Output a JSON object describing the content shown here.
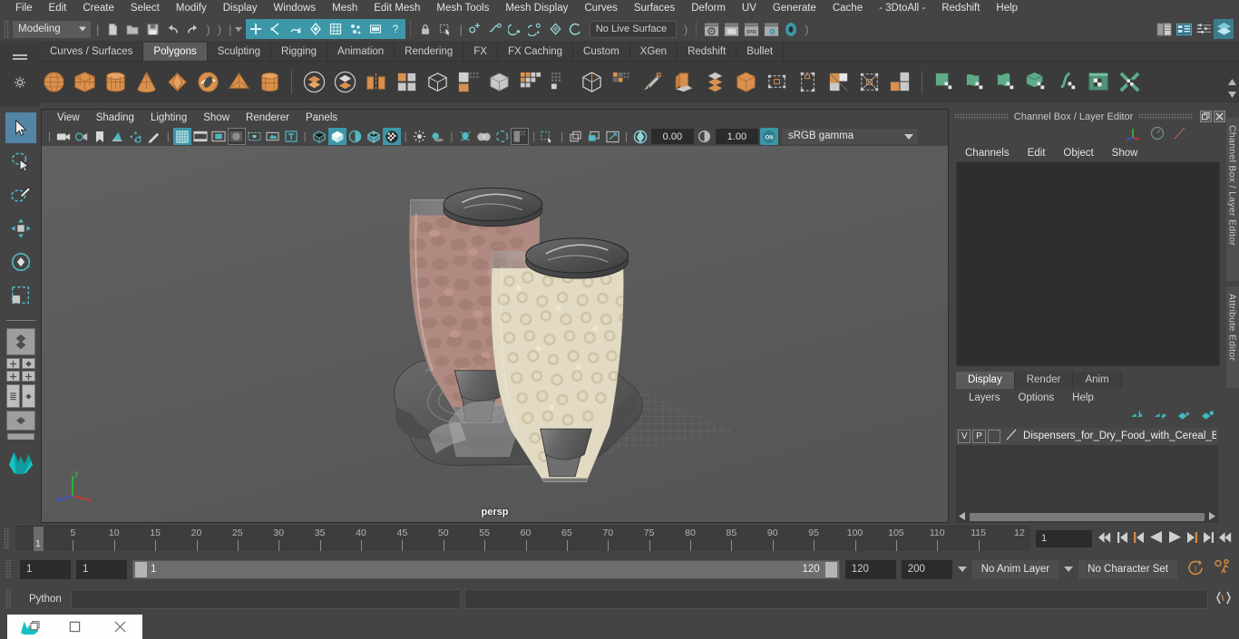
{
  "menubar": {
    "items": [
      "File",
      "Edit",
      "Create",
      "Select",
      "Modify",
      "Display",
      "Windows",
      "Mesh",
      "Edit Mesh",
      "Mesh Tools",
      "Mesh Display",
      "Curves",
      "Surfaces",
      "Deform",
      "UV",
      "Generate",
      "Cache",
      "- 3DtoAll -",
      "Redshift",
      "Help"
    ]
  },
  "statusline": {
    "menuset": "Modeling",
    "live_surface": "No Live Surface",
    "icons": [
      "new-scene-icon",
      "open-scene-icon",
      "save-scene-icon",
      "undo-icon",
      "redo-icon",
      "select-by-hierarchy-icon",
      "select-by-object-icon",
      "select-by-component-icon",
      "select-mask-icon",
      "snap-to-grid-icon",
      "snap-to-curve-icon",
      "snap-to-point-icon",
      "snap-to-projected-center-icon",
      "snap-to-view-plane-icon",
      "make-live-icon",
      "lock-icon",
      "selection-highlight-icon",
      "construction-history-icon",
      "render-current-frame-icon",
      "ipr-render-icon",
      "render-settings-icon",
      "hypershade-icon",
      "outliner-icon",
      "attribute-editor-icon",
      "tool-settings-icon",
      "channel-box-icon"
    ]
  },
  "shelf": {
    "tabs": [
      "Curves / Surfaces",
      "Polygons",
      "Sculpting",
      "Rigging",
      "Animation",
      "Rendering",
      "FX",
      "FX Caching",
      "Custom",
      "XGen",
      "Redshift",
      "Bullet"
    ],
    "active_tab": "Polygons",
    "icons": [
      "poly-sphere-icon",
      "poly-cube-icon",
      "poly-cylinder-icon",
      "poly-cone-icon",
      "poly-plane-icon",
      "poly-torus-icon",
      "poly-pyramid-icon",
      "poly-prism-icon",
      "combine-icon",
      "separate-icon",
      "extract-icon",
      "poly-booleans-icon",
      "smooth-icon",
      "sculpt-geometry-icon",
      "bevel-icon",
      "extrude-icon",
      "merge-icon",
      "quad-draw-icon",
      "multi-cut-icon",
      "insert-edge-loop-icon",
      "offset-edge-loop-icon",
      "add-divisions-icon",
      "mirror-icon",
      "append-polygon-icon",
      "target-weld-icon",
      "crease-icon",
      "fill-hole-icon",
      "uv-editor-icon",
      "uv-planar-icon",
      "uv-cylindrical-icon",
      "uv-automatic-icon",
      "uv-unfold-icon",
      "uv-layout-icon",
      "uv-snapshot-icon"
    ]
  },
  "toolbox": {
    "items": [
      "select-tool",
      "lasso-select-tool",
      "paint-select-tool",
      "move-tool",
      "rotate-tool",
      "scale-tool",
      "last-tool-used",
      "quad-view-layout",
      "two-pane-layout",
      "outliner-persp-layout",
      "hypergraph-layout",
      "maya-logo"
    ]
  },
  "viewport": {
    "menus": [
      "View",
      "Shading",
      "Lighting",
      "Show",
      "Renderer",
      "Panels"
    ],
    "camera_label": "persp",
    "exposure": "0.00",
    "gamma": "1.00",
    "color_space": "sRGB gamma",
    "toolbar_icons": [
      "select-camera-icon",
      "camera-attributes-icon",
      "bookmark-icon",
      "image-plane-icon",
      "2d-pan-zoom-icon",
      "grease-pencil-icon",
      "grid-icon",
      "film-gate-icon",
      "resolution-gate-icon",
      "gate-mask-icon",
      "film-origin-icon",
      "xray-icon",
      "text-overlay-icon",
      "wireframe-icon",
      "smooth-shade-icon",
      "flat-shade-icon",
      "wireframe-on-shaded-icon",
      "texture-icon",
      "lights-icon",
      "shadows-icon",
      "ao-icon",
      "motion-blur-icon",
      "aa-icon",
      "isolate-select-icon",
      "xray-joints-icon",
      "display-layers-icon",
      "panel-zoom-icon",
      "exposure-icon",
      "gamma-icon",
      "color-management-icon"
    ],
    "axis": {
      "x": "x",
      "y": "y",
      "z": "z",
      "x_color": "#e03535",
      "y_color": "#2fc02f",
      "z_color": "#2f51e0"
    }
  },
  "right_panel": {
    "title": "Channel Box / Layer Editor",
    "channel_menus": [
      "Channels",
      "Edit",
      "Object",
      "Show"
    ],
    "layer_tabs": [
      "Display",
      "Render",
      "Anim"
    ],
    "layer_active_tab": "Display",
    "layer_menus": [
      "Layers",
      "Options",
      "Help"
    ],
    "layers": [
      {
        "visibility": "V",
        "playback": "P",
        "reference": "",
        "name": "Dispensers_for_Dry_Food_with_Cereal_Blä"
      }
    ],
    "side_tabs": [
      "Channel Box / Layer Editor",
      "Attribute Editor"
    ]
  },
  "timeline": {
    "ticks": [
      5,
      10,
      15,
      20,
      25,
      30,
      35,
      40,
      45,
      50,
      55,
      60,
      65,
      70,
      75,
      80,
      85,
      90,
      95,
      100,
      105,
      110,
      115
    ],
    "last_partial_label": "12",
    "current_frame_marker": "1",
    "current_frame_field": "1",
    "playback_buttons": [
      "go-to-start-icon",
      "step-back-keyframe-icon",
      "step-back-frame-icon",
      "play-backwards-icon",
      "play-forwards-icon",
      "step-forward-frame-icon",
      "step-forward-keyframe-icon",
      "go-to-end-icon"
    ]
  },
  "range": {
    "anim_start": "1",
    "range_start": "1",
    "slider_start_label": "1",
    "slider_end_label": "120",
    "range_end": "120",
    "anim_end": "200",
    "anim_layer": "No Anim Layer",
    "character_set": "No Character Set",
    "auto_key_icon": "auto-keyframe-icon",
    "anim_prefs_icon": "animation-preferences-icon"
  },
  "command_line": {
    "language_label": "Python",
    "input_value": "",
    "result_value": ""
  },
  "taskbar": {
    "buttons": [
      "maya-app-icon",
      "restore-window-icon",
      "minimize-window-icon",
      "close-window-icon"
    ]
  },
  "colors": {
    "accent_teal": "#3c97a8",
    "accent_blue": "#5285a6",
    "shelf_orange": "#d88b4e",
    "shelf_green": "#5eab88",
    "panel_bg": "#444444",
    "viewport_bg": "#5b5b5b"
  }
}
